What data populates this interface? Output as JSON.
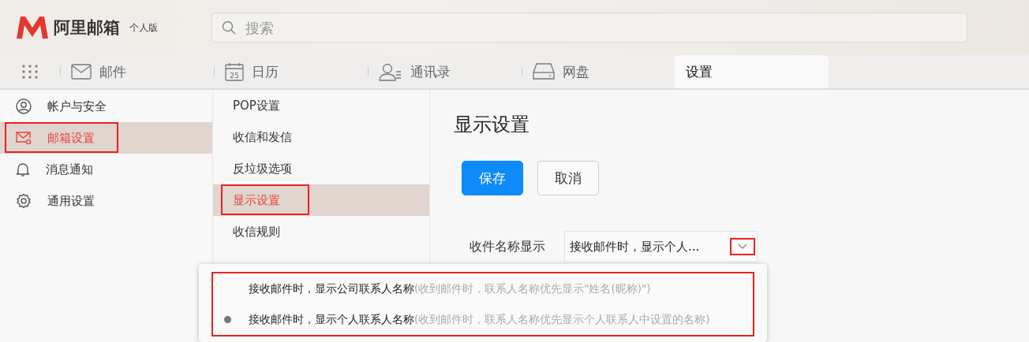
{
  "brand": {
    "name": "阿里邮箱",
    "edition": "个人版"
  },
  "search": {
    "placeholder": "搜索"
  },
  "tabs": [
    {
      "kind": "mail",
      "label": "邮件",
      "selected": false
    },
    {
      "kind": "calendar",
      "label": "日历",
      "icon_text": "25",
      "selected": false
    },
    {
      "kind": "contacts",
      "label": "通讯录",
      "selected": false
    },
    {
      "kind": "disk",
      "label": "网盘",
      "selected": false
    },
    {
      "kind": "none",
      "label": "设置",
      "selected": true
    }
  ],
  "sidebar": {
    "items": [
      {
        "kind": "user",
        "label": "帐户与安全",
        "selected": false,
        "annotated": false
      },
      {
        "kind": "mailbox",
        "label": "邮箱设置",
        "selected": true,
        "annotated": true
      },
      {
        "kind": "bell",
        "label": "消息通知",
        "selected": false,
        "annotated": false
      },
      {
        "kind": "gear",
        "label": "通用设置",
        "selected": false,
        "annotated": false
      }
    ]
  },
  "subnav": {
    "items": [
      {
        "label": "POP设置",
        "selected": false,
        "annotated": false
      },
      {
        "label": "收信和发信",
        "selected": false,
        "annotated": false
      },
      {
        "label": "反垃圾选项",
        "selected": false,
        "annotated": false
      },
      {
        "label": "显示设置",
        "selected": true,
        "annotated": true
      },
      {
        "label": "收信规则",
        "selected": false,
        "annotated": false
      }
    ]
  },
  "content": {
    "title": "显示设置",
    "buttons": [
      {
        "kind": "primary",
        "label": "保存"
      },
      {
        "kind": "default",
        "label": "取消"
      }
    ],
    "field": {
      "label": "收件名称显示",
      "value": "接收邮件时，显示个人...",
      "expanded": true,
      "caret_annotated": true
    }
  },
  "dropdown": {
    "annotated": true,
    "options": [
      {
        "label": "接收邮件时，显示公司联系人名称",
        "hint": "(收到邮件时，联系人名称优先显示\"姓名(昵称)\")",
        "selected": false
      },
      {
        "label": "接收邮件时，显示个人联系人名称",
        "hint": "(收到邮件时，联系人名称优先显示个人联系人中设置的名称)",
        "selected": true
      }
    ]
  }
}
